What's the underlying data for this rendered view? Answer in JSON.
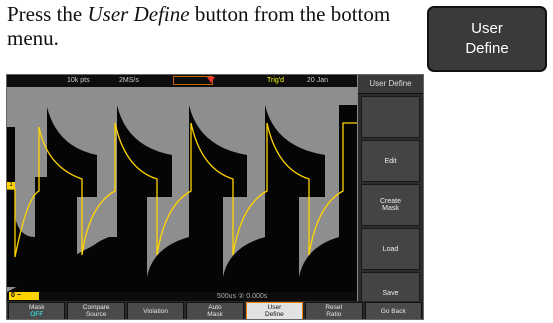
{
  "instruction": {
    "prefix": "Press the ",
    "emphasis": "User Define",
    "suffix": " button from the bottom menu."
  },
  "reference_button": {
    "line1": "User",
    "line2": "Define"
  },
  "scope": {
    "topbar": {
      "points": "10k pts",
      "rate": "2MS/s",
      "trig": "Trig'd",
      "time": "20 Jan"
    },
    "status": {
      "ch1": "0 − 50mV",
      "timebase": "500us  ②  0.000s"
    },
    "red_note": "",
    "right_menu": {
      "title": "User Define",
      "buttons": [
        "",
        "Edit",
        "Create\nMask",
        "Load",
        "Save"
      ]
    },
    "bottom_menu": [
      {
        "label": "Mask",
        "sub": "OFF"
      },
      {
        "label": "Compare",
        "sub": "Source"
      },
      {
        "label": "Violation",
        "sub": ""
      },
      {
        "label": "Auto",
        "sub": "Mask"
      },
      {
        "label": "User",
        "sub": "Define",
        "active": true
      },
      {
        "label": "Reset",
        "sub": "Ratio"
      },
      {
        "label": "Go Back",
        "sub": ""
      }
    ],
    "colors": {
      "waveform": "#ffd400",
      "background": "#0f0f0f",
      "mask": "#a0a0a0"
    }
  }
}
